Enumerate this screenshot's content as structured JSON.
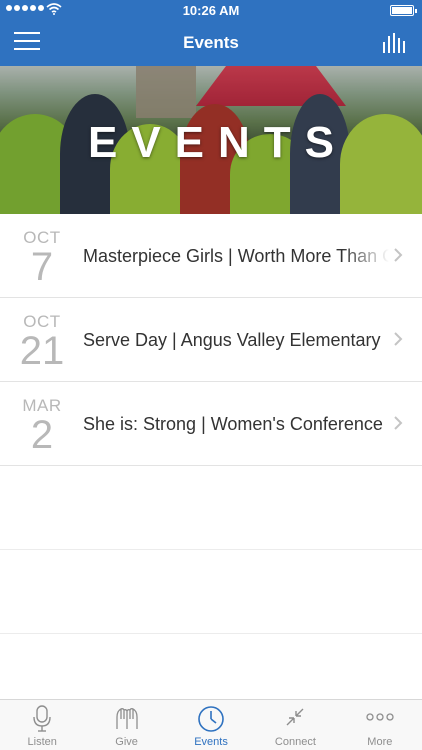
{
  "status_bar": {
    "time": "10:26 AM"
  },
  "header": {
    "title": "Events"
  },
  "hero": {
    "title": "EVENTS"
  },
  "events": [
    {
      "month": "OCT",
      "day": "7",
      "name": "Masterpiece Girls | Worth More Than Gold"
    },
    {
      "month": "OCT",
      "day": "21",
      "name": "Serve Day | Angus Valley Elementary"
    },
    {
      "month": "MAR",
      "day": "2",
      "name": "She is: Strong | Women's Conference"
    }
  ],
  "tabs": [
    {
      "label": "Listen",
      "icon": "microphone-icon"
    },
    {
      "label": "Give",
      "icon": "hands-icon"
    },
    {
      "label": "Events",
      "icon": "clock-icon",
      "active": true
    },
    {
      "label": "Connect",
      "icon": "arrows-inward-icon"
    },
    {
      "label": "More",
      "icon": "dots-icon"
    }
  ],
  "colors": {
    "brand": "#2f72c0",
    "inactive": "#8e8e8e",
    "date_text": "#b8b8b8"
  }
}
